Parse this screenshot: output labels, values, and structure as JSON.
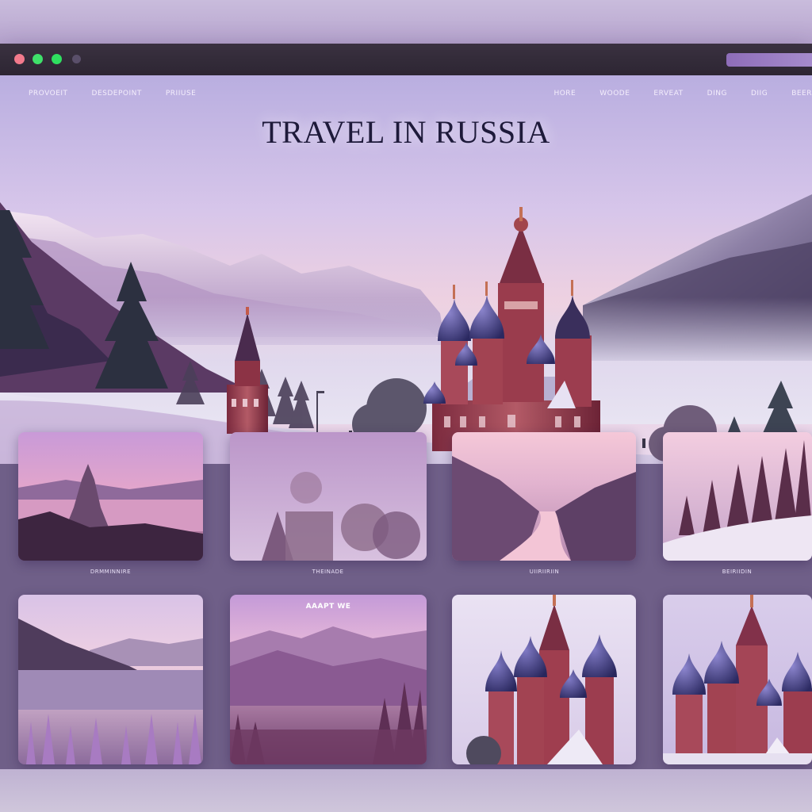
{
  "window": {
    "controls": [
      "close",
      "minimize",
      "maximize",
      "extra"
    ],
    "colors": {
      "close": "#f27a8c",
      "minimize": "#3fe06a",
      "maximize": "#2fe060",
      "accent": "#8e6db9"
    }
  },
  "nav": {
    "left": [
      {
        "label": "PROVOEIT"
      },
      {
        "label": "DESDEPOINT"
      },
      {
        "label": "PRIIUSE"
      }
    ],
    "right": [
      {
        "label": "HORE"
      },
      {
        "label": "WOODE"
      },
      {
        "label": "ERVEAT"
      },
      {
        "label": "DING"
      },
      {
        "label": "DIIG"
      },
      {
        "label": "BEER"
      }
    ]
  },
  "hero": {
    "title": "TRAVEL IN RUSSIA"
  },
  "cards": [
    {
      "caption": "DRMMINNIRE"
    },
    {
      "caption": "THEINADE"
    },
    {
      "caption": "UIIRIIRIIN"
    },
    {
      "caption": "BEIRIIDIN"
    },
    {
      "caption": ""
    },
    {
      "caption": "",
      "overlay": "AAAPT WE"
    },
    {
      "caption": ""
    },
    {
      "caption": ""
    }
  ]
}
